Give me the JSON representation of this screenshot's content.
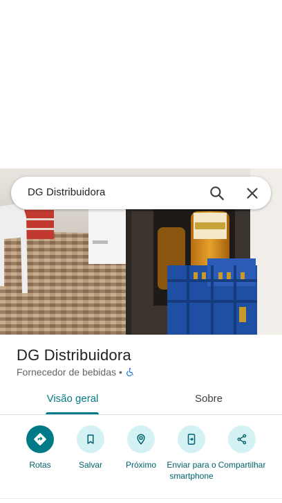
{
  "search": {
    "query": "DG Distribuidora",
    "search_icon": "search-icon",
    "close_icon": "close-icon"
  },
  "photo": {
    "description_icon": "storefront-photo"
  },
  "place": {
    "name": "DG Distribuidora",
    "category": "Fornecedor de bebidas",
    "separator": "•",
    "accessibility_icon": "wheelchair-icon"
  },
  "tabs": [
    {
      "label": "Visão geral",
      "selected": true
    },
    {
      "label": "Sobre",
      "selected": false
    }
  ],
  "actions": [
    {
      "label": "Rotas",
      "icon": "directions-icon"
    },
    {
      "label": "Salvar",
      "icon": "bookmark-icon"
    },
    {
      "label": "Próximo",
      "icon": "nearby-icon"
    },
    {
      "label": "Enviar para o smartphone",
      "icon": "send-to-phone-icon"
    },
    {
      "label": "Compartilhar",
      "icon": "share-icon"
    }
  ],
  "colors": {
    "accent": "#007a87",
    "action_bg": "#d4f1f4",
    "text_primary": "#202124",
    "text_secondary": "#5f6368",
    "accessibility_blue": "#1a73e8"
  }
}
